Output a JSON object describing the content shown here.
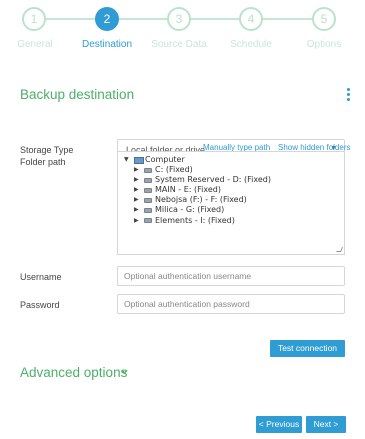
{
  "stepper": {
    "steps": [
      {
        "number": "1",
        "label": "General"
      },
      {
        "number": "2",
        "label": "Destination"
      },
      {
        "number": "3",
        "label": "Source Data"
      },
      {
        "number": "4",
        "label": "Schedule"
      },
      {
        "number": "5",
        "label": "Options"
      }
    ],
    "active_index": 1
  },
  "destination": {
    "title": "Backup destination",
    "storage_type_label": "Storage Type",
    "storage_type_value": "Local folder or drive",
    "manual_path_link": "Manually type path",
    "hidden_folders_link": "Show hidden folders",
    "folder_path_label": "Folder path",
    "tree": {
      "root": "Computer",
      "children": [
        "C: (Fixed)",
        "System Reserved - D: (Fixed)",
        "MAIN - E: (Fixed)",
        "Nebojsa (F:) - F: (Fixed)",
        "Milica - G: (Fixed)",
        "Elements - I: (Fixed)"
      ]
    },
    "username_label": "Username",
    "username_placeholder": "Optional authentication username",
    "password_label": "Password",
    "password_placeholder": "Optional authentication password",
    "test_button": "Test connection"
  },
  "advanced": {
    "title": "Advanced options"
  },
  "nav": {
    "previous": "< Previous",
    "next": "Next >"
  },
  "colors": {
    "accent": "#2f9cd4",
    "section_title": "#4caf6b",
    "step_inactive": "#b9e3cc"
  }
}
